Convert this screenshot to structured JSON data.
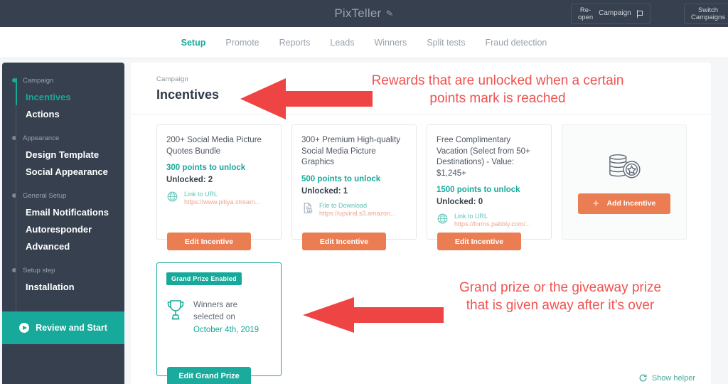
{
  "topbar": {
    "brand": "PixTeller",
    "edit_icon": "pencil-icon",
    "reopen_label": "Re-\nopen",
    "reopen_line1": "Re-",
    "reopen_line2": "open",
    "campaign_label": "Campaign",
    "flag_icon": "flag-icon",
    "switch_line1": "Switch",
    "switch_line2": "Campaigns"
  },
  "nav": {
    "tabs": [
      {
        "label": "Setup",
        "active": true
      },
      {
        "label": "Promote",
        "active": false
      },
      {
        "label": "Reports",
        "active": false
      },
      {
        "label": "Leads",
        "active": false
      },
      {
        "label": "Winners",
        "active": false
      },
      {
        "label": "Split tests",
        "active": false
      },
      {
        "label": "Fraud detection",
        "active": false
      }
    ]
  },
  "sidebar": {
    "groups": [
      {
        "title": "Campaign",
        "items": [
          {
            "label": "Incentives",
            "active": true
          },
          {
            "label": "Actions",
            "active": false
          }
        ]
      },
      {
        "title": "Appearance",
        "items": [
          {
            "label": "Design Template",
            "active": false
          },
          {
            "label": "Social Appearance",
            "active": false
          }
        ]
      },
      {
        "title": "General Setup",
        "items": [
          {
            "label": "Email Notifications",
            "active": false
          },
          {
            "label": "Autoresponder",
            "active": false
          },
          {
            "label": "Advanced",
            "active": false
          }
        ]
      },
      {
        "title": "Setup step",
        "items": [
          {
            "label": "Installation",
            "active": false
          }
        ]
      }
    ],
    "review_button": "Review and Start"
  },
  "main": {
    "breadcrumb": "Campaign",
    "title": "Incentives",
    "incentives": [
      {
        "title": "200+ Social Media Picture Quotes Bundle",
        "points": "300 points to unlock",
        "unlocked": "Unlocked: 2",
        "link_icon": "globe-icon",
        "link_label": "Link to URL",
        "link_url": "https://www.pitiya.stream...",
        "edit_label": "Edit Incentive"
      },
      {
        "title": "300+ Premium High-quality Social Media Picture Graphics",
        "points": "500 points to unlock",
        "unlocked": "Unlocked: 1",
        "link_icon": "file-download-icon",
        "link_label": "File to Download",
        "link_url": "https://upviral.s3.amazon...",
        "edit_label": "Edit Incentive"
      },
      {
        "title": "Free Complimentary Vacation (Select from 50+ Destinations) - Value: $1,245+",
        "points": "1500 points to unlock",
        "unlocked": "Unlocked: 0",
        "link_icon": "globe-icon",
        "link_label": "Link to URL",
        "link_url": "https://forms.pabbly.com/...",
        "edit_label": "Edit Incentive"
      }
    ],
    "add_card": {
      "icon": "coins-badge-icon",
      "label": "Add Incentive",
      "plus": "+"
    },
    "grand_prize": {
      "badge": "Grand Prize Enabled",
      "trophy_icon": "trophy-icon",
      "text_line1": "Winners are",
      "text_line2": "selected on",
      "date": "October 4th, 2019",
      "edit_label": "Edit Grand Prize"
    },
    "show_helper": {
      "icon": "helper-refresh-icon",
      "label": "Show helper"
    }
  },
  "annotations": [
    {
      "id": "anno-rewards",
      "text": "Rewards that are unlocked when a certain points mark is reached",
      "color": "#ef5350",
      "arrow": "left-arrow"
    },
    {
      "id": "anno-grand-prize",
      "text": "Grand prize or the giveaway prize that is given away after it's over",
      "color": "#ef5350",
      "arrow": "left-arrow"
    }
  ],
  "colors": {
    "topbar_bg": "#36404e",
    "sidebar_bg": "#36404e",
    "accent_teal": "#17a99a",
    "accent_orange": "#ea7d52",
    "annotation_red": "#ef5350",
    "page_bg": "#f5f6f7"
  }
}
